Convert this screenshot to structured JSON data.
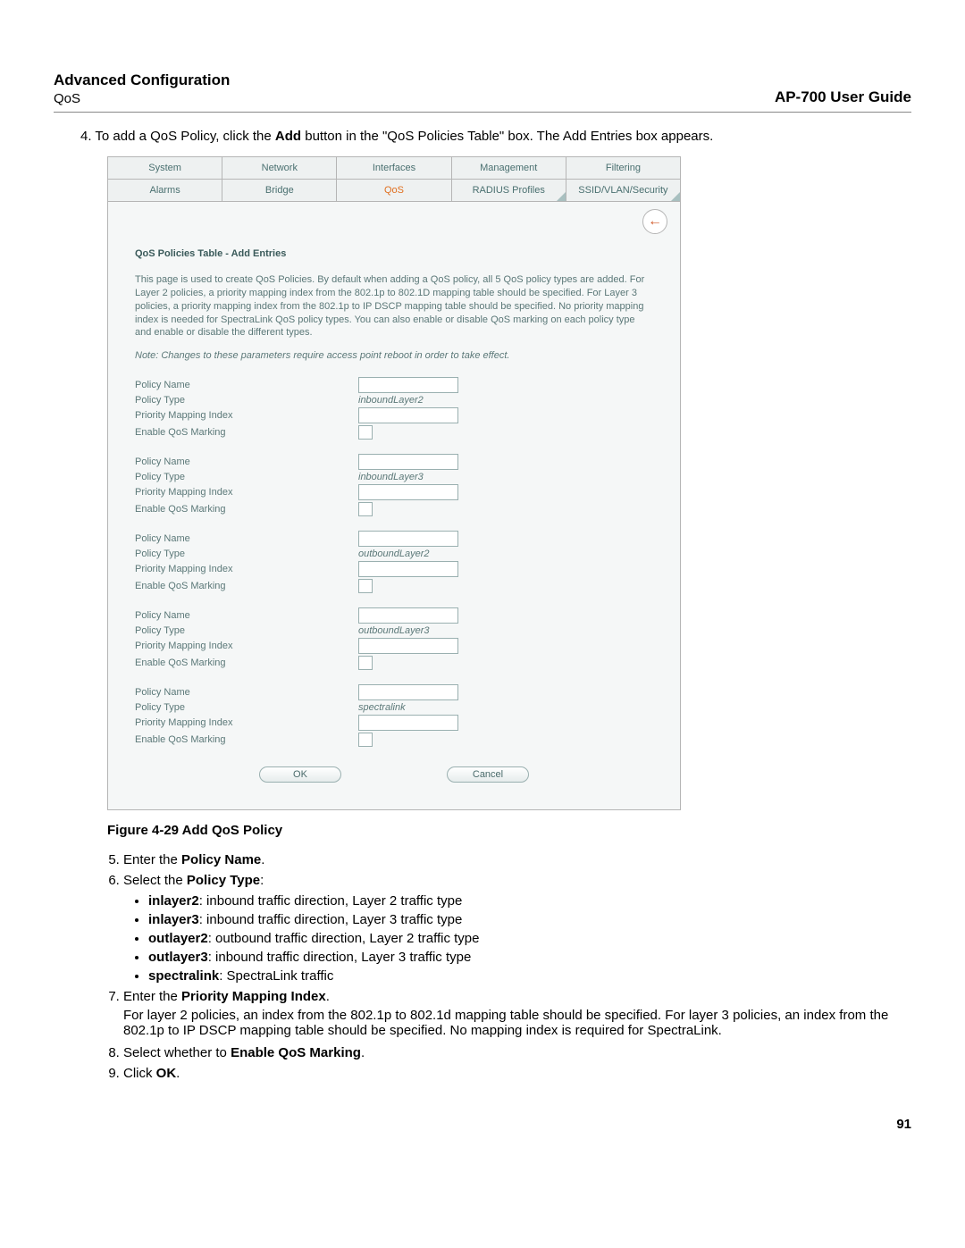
{
  "header": {
    "left_title": "Advanced Configuration",
    "left_sub": "QoS",
    "right": "AP-700 User Guide"
  },
  "intro": {
    "num": "4.",
    "text_before": "  To add a QoS Policy, click the ",
    "bold1": "Add",
    "text_mid": " button in the \"QoS Policies Table\" box. The Add Entries box appears."
  },
  "ui": {
    "tabs_row1": [
      "System",
      "Network",
      "Interfaces",
      "Management",
      "Filtering"
    ],
    "tabs_row2": [
      "Alarms",
      "Bridge",
      "QoS",
      "RADIUS Profiles",
      "SSID/VLAN/Security"
    ],
    "active_tab": "QoS",
    "back_icon": "←",
    "heading": "QoS Policies Table - Add Entries",
    "para": "This page is used to create QoS Policies. By default when adding a QoS policy, all 5 QoS policy types are added. For Layer 2 policies, a priority mapping index from the 802.1p to 802.1D mapping table should be specified. For Layer 3 policies, a priority mapping index from the 802.1p to IP DSCP mapping table should be specified. No priority mapping index is needed for SpectraLink QoS policy types. You can also enable or disable QoS marking on each policy type and enable or disable the different types.",
    "note": "Note: Changes to these parameters require access point reboot in order to take effect.",
    "labels": {
      "policy_name": "Policy Name",
      "policy_type": "Policy Type",
      "pm_index": "Priority Mapping Index",
      "enable_qos": "Enable QoS Marking"
    },
    "groups": [
      {
        "type": "inboundLayer2"
      },
      {
        "type": "inboundLayer3"
      },
      {
        "type": "outboundLayer2"
      },
      {
        "type": "outboundLayer3"
      },
      {
        "type": "spectralink"
      }
    ],
    "ok": "OK",
    "cancel": "Cancel"
  },
  "figure_caption": "Figure 4-29 Add QoS Policy",
  "steps": {
    "s5": {
      "pre": "Enter the ",
      "b": "Policy Name",
      "post": "."
    },
    "s6": {
      "pre": "Select the ",
      "b": "Policy Type",
      "post": ":"
    },
    "bullets": [
      {
        "b": "inlayer2",
        "rest": ": inbound traffic direction, Layer 2 traffic type"
      },
      {
        "b": "inlayer3",
        "rest": ": inbound traffic direction, Layer 3 traffic type"
      },
      {
        "b": "outlayer2",
        "rest": ": outbound traffic direction, Layer 2 traffic type"
      },
      {
        "b": "outlayer3",
        "rest": ": inbound traffic direction, Layer 3 traffic type"
      },
      {
        "b": "spectralink",
        "rest": ": SpectraLink traffic"
      }
    ],
    "s7": {
      "pre": "Enter the ",
      "b": "Priority Mapping Index",
      "post": "."
    },
    "s7_para": "For layer 2 policies, an index from the 802.1p to 802.1d mapping table should be specified. For layer 3 policies, an index from the 802.1p to IP DSCP mapping table should be specified. No mapping index is required for SpectraLink.",
    "s8": {
      "pre": "Select whether to ",
      "b": "Enable QoS Marking",
      "post": "."
    },
    "s9": {
      "pre": "Click ",
      "b": "OK",
      "post": "."
    }
  },
  "page_number": "91"
}
